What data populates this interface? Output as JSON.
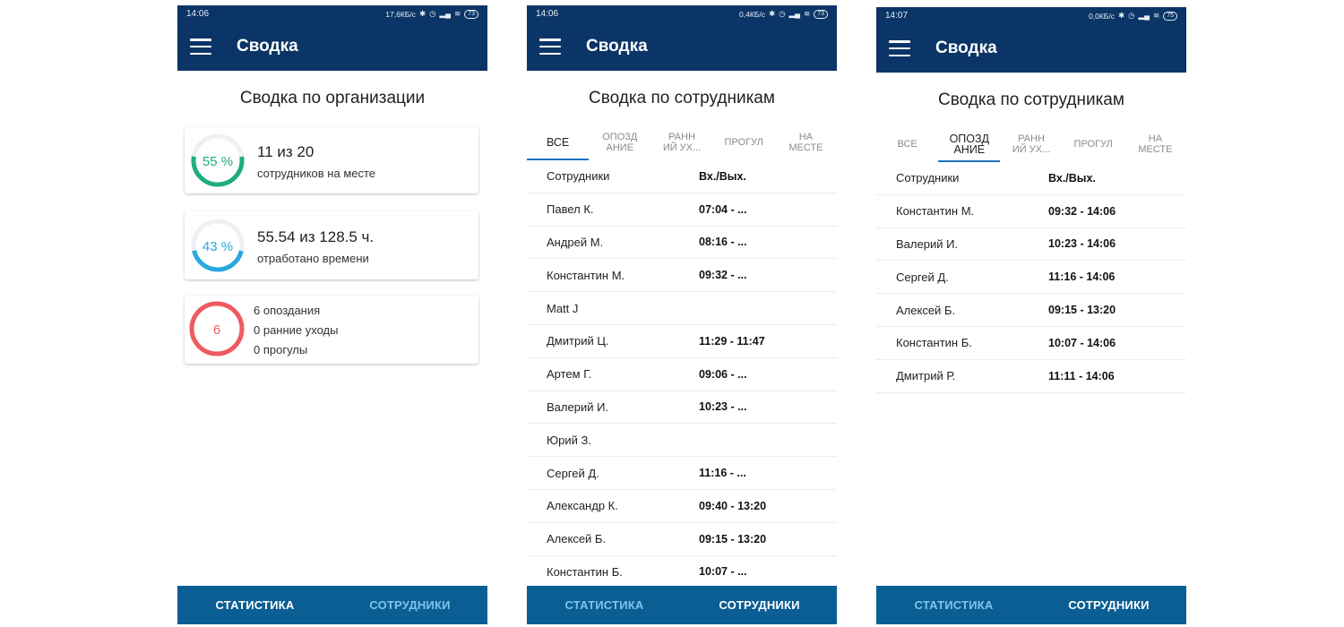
{
  "phones": [
    {
      "status": {
        "time": "14:06",
        "speed": "17,6КБ/с",
        "battery": "73"
      },
      "app_title": "Сводка",
      "screen_title": "Сводка по организации",
      "cards": [
        {
          "ring_label": "55 %",
          "ring_percent": 55,
          "ring_color": "#1fae7a",
          "big": "11 из 20",
          "small": "сотрудников на месте"
        },
        {
          "ring_label": "43 %",
          "ring_percent": 43,
          "ring_color": "#29a8e0",
          "big": "55.54 из 128.5 ч.",
          "small": "отработано времени"
        },
        {
          "ring_label": "6",
          "ring_percent": 100,
          "ring_color": "#ef5a5f",
          "lines": [
            "6 опоздания",
            "0 ранние уходы",
            "0 прогулы"
          ]
        }
      ],
      "nav": {
        "stats": "СТАТИСТИКА",
        "employees": "СОТРУДНИКИ",
        "active": "stats"
      }
    },
    {
      "status": {
        "time": "14:06",
        "speed": "0,4КБ/с",
        "battery": "73"
      },
      "app_title": "Сводка",
      "screen_title": "Сводка по сотрудникам",
      "tabs": [
        "ВСЕ",
        "ОПОЗД\nАНИЕ",
        "РАНН\nИЙ УХ...",
        "ПРОГУЛ",
        "НА\nМЕСТЕ"
      ],
      "active_tab": 0,
      "header": {
        "name": "Сотрудники",
        "time": "Вх./Вых."
      },
      "rows": [
        {
          "name": "Павел  К.",
          "time": "07:04 - ..."
        },
        {
          "name": "Андрей  М.",
          "time": "08:16 - ..."
        },
        {
          "name": "Константин  М.",
          "time": "09:32 - ..."
        },
        {
          "name": "Matt  J",
          "time": ""
        },
        {
          "name": "Дмитрий  Ц.",
          "time": "11:29 - 11:47"
        },
        {
          "name": "Артем  Г.",
          "time": "09:06 - ..."
        },
        {
          "name": "Валерий  И.",
          "time": "10:23 - ..."
        },
        {
          "name": "Юрий  З.",
          "time": ""
        },
        {
          "name": "Сергей  Д.",
          "time": "11:16 - ..."
        },
        {
          "name": "Александр  К.",
          "time": "09:40 - 13:20"
        },
        {
          "name": "Алексей  Б.",
          "time": "09:15 - 13:20"
        },
        {
          "name": "Константин  Б.",
          "time": "10:07 - ..."
        }
      ],
      "nav": {
        "stats": "СТАТИСТИКА",
        "employees": "СОТРУДНИКИ",
        "active": "employees"
      }
    },
    {
      "status": {
        "time": "14:07",
        "speed": "0,0КБ/с",
        "battery": "75"
      },
      "app_title": "Сводка",
      "screen_title": "Сводка по сотрудникам",
      "tabs": [
        "ВСЕ",
        "ОПОЗД\nАНИЕ",
        "РАНН\nИЙ УХ...",
        "ПРОГУЛ",
        "НА\nМЕСТЕ"
      ],
      "active_tab": 1,
      "header": {
        "name": "Сотрудники",
        "time": "Вх./Вых."
      },
      "rows": [
        {
          "name": "Константин  М.",
          "time": "09:32 - 14:06"
        },
        {
          "name": "Валерий  И.",
          "time": "10:23 - 14:06"
        },
        {
          "name": "Сергей  Д.",
          "time": "11:16 - 14:06"
        },
        {
          "name": "Алексей  Б.",
          "time": "09:15 - 13:20"
        },
        {
          "name": "Константин  Б.",
          "time": "10:07 - 14:06"
        },
        {
          "name": "Дмитрий  Р.",
          "time": "11:11 - 14:06"
        }
      ],
      "nav": {
        "stats": "СТАТИСТИКА",
        "employees": "СОТРУДНИКИ",
        "active": "employees"
      }
    }
  ]
}
